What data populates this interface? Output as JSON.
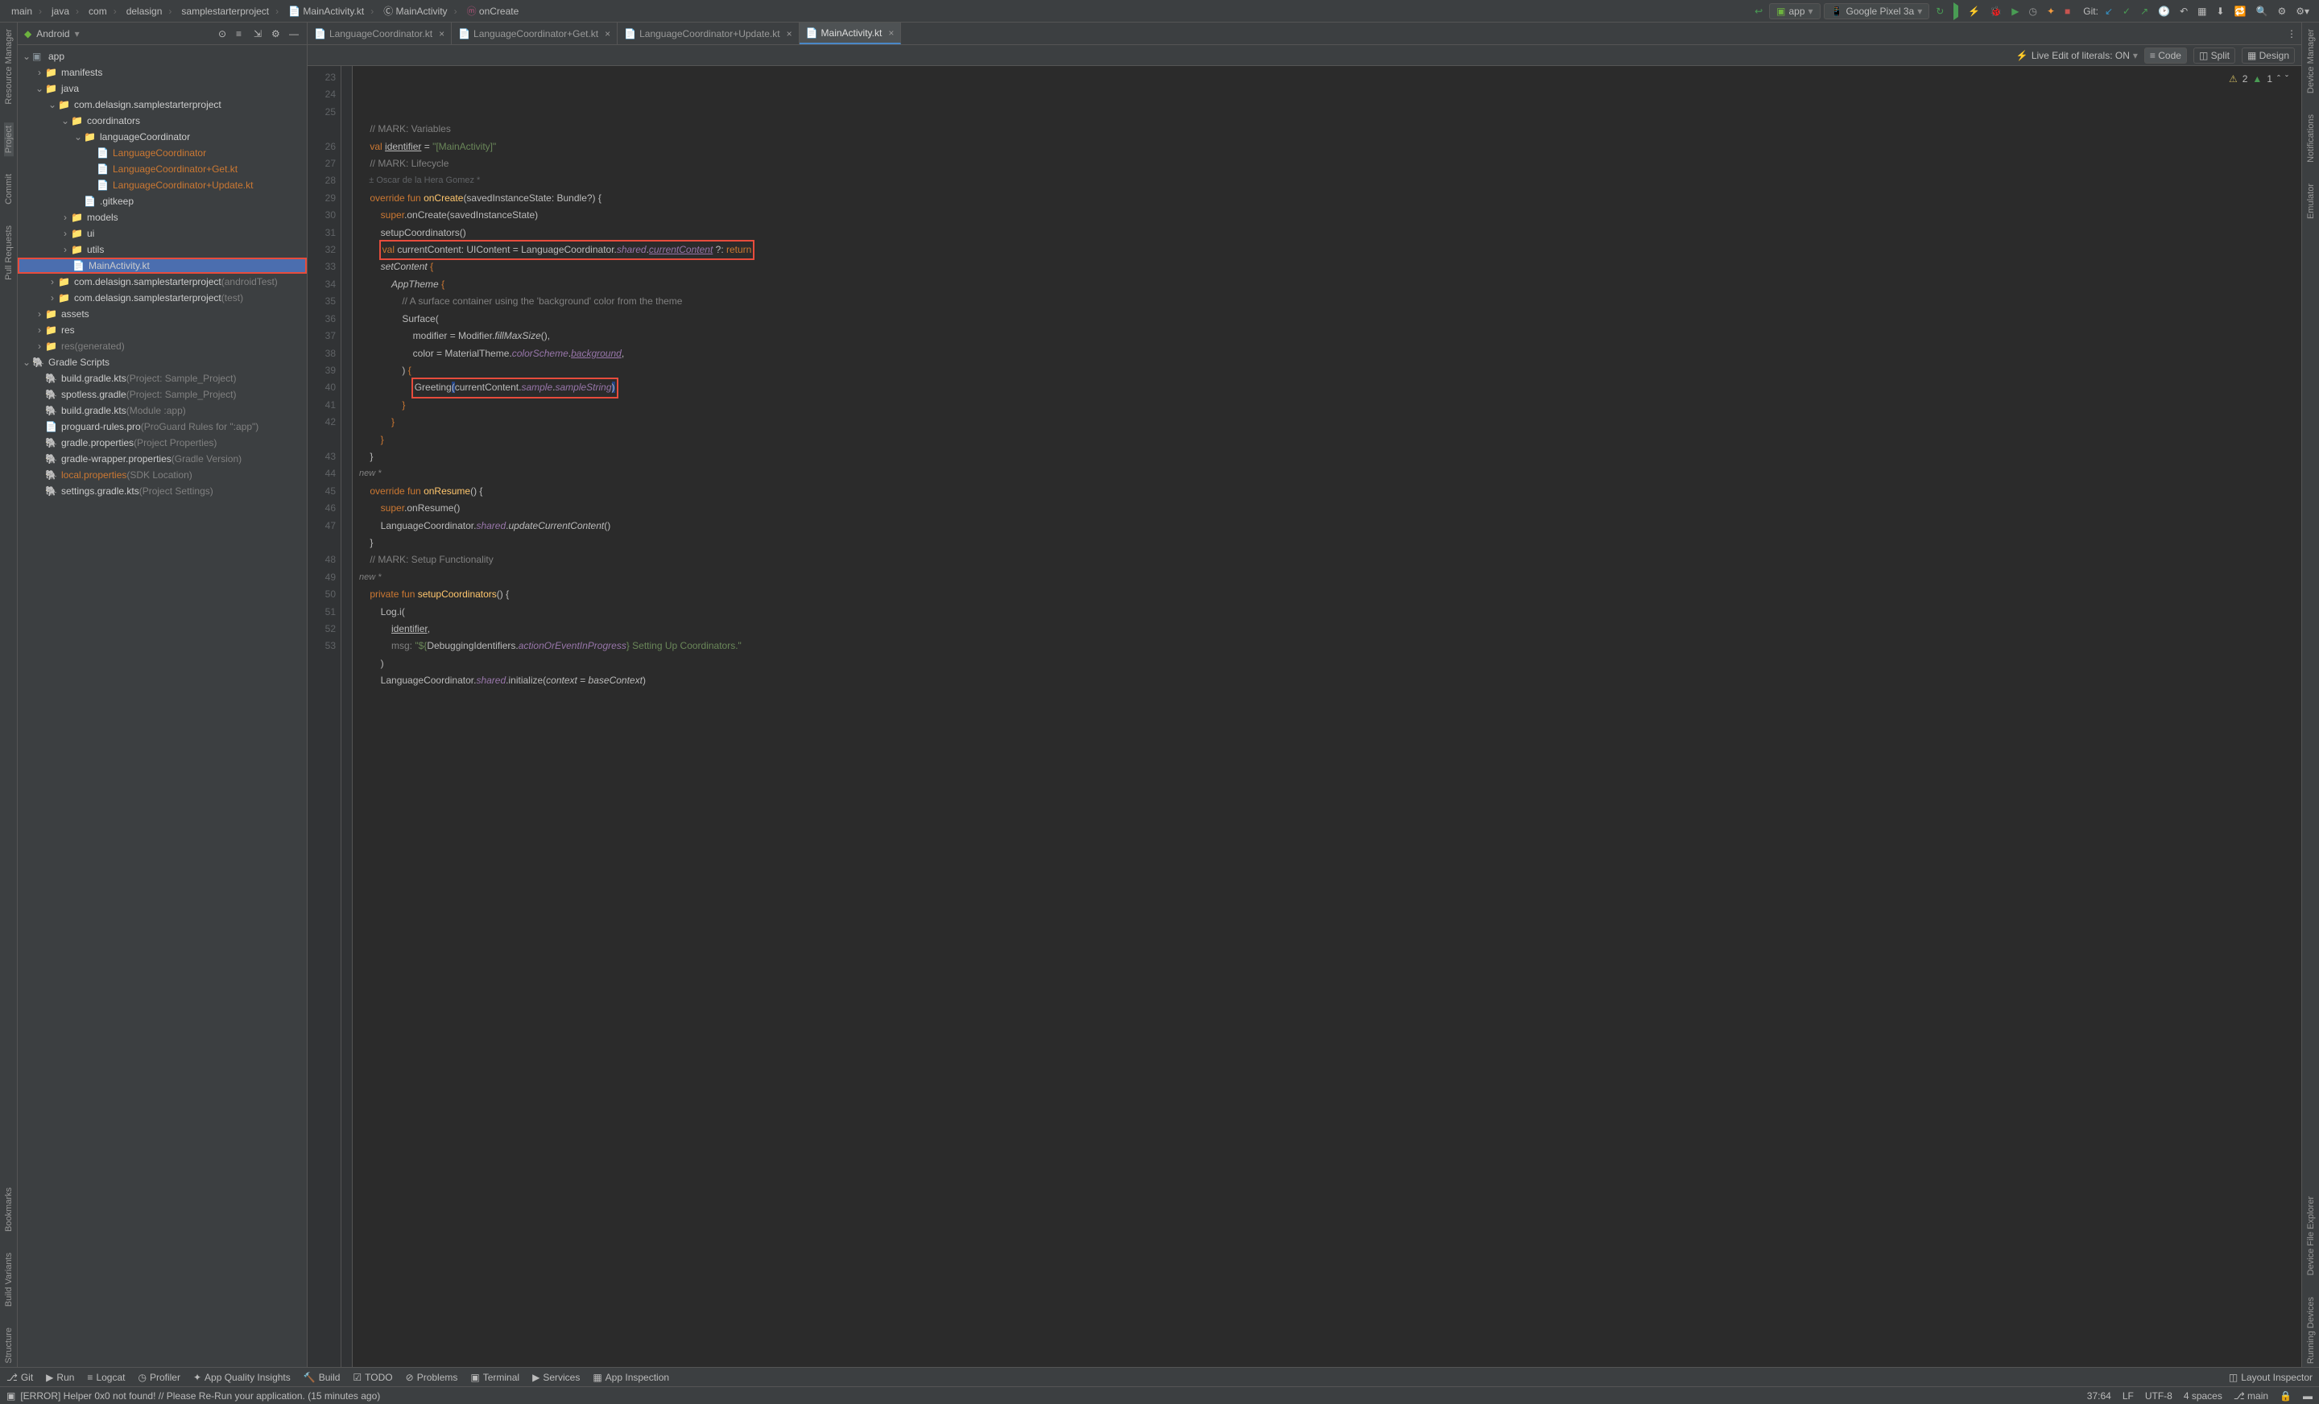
{
  "breadcrumbs": [
    "main",
    "java",
    "com",
    "delasign",
    "samplestarterproject",
    "MainActivity.kt",
    "MainActivity",
    "onCreate"
  ],
  "run_config": "app",
  "device_target": "Google Pixel 3a",
  "git_label": "Git:",
  "left_tools": {
    "resource_manager": "Resource Manager",
    "project": "Project",
    "commit": "Commit",
    "pull_requests": "Pull Requests",
    "bookmarks": "Bookmarks",
    "build_variants": "Build Variants",
    "structure": "Structure"
  },
  "right_tools": {
    "device_manager": "Device Manager",
    "notifications": "Notifications",
    "emulator": "Emulator",
    "device_file_explorer": "Device File Explorer",
    "running_devices": "Running Devices"
  },
  "project_panel": {
    "title": "Android",
    "tree": [
      {
        "d": 0,
        "t": "app",
        "icon": "module",
        "open": true
      },
      {
        "d": 1,
        "t": "manifests",
        "icon": "folder",
        "open": false,
        "arrow": ">"
      },
      {
        "d": 1,
        "t": "java",
        "icon": "folder",
        "open": true,
        "arrow": "v"
      },
      {
        "d": 2,
        "t": "com.delasign.samplestarterproject",
        "icon": "pkg",
        "open": true,
        "arrow": "v"
      },
      {
        "d": 3,
        "t": "coordinators",
        "icon": "pkg",
        "open": true,
        "arrow": "v"
      },
      {
        "d": 4,
        "t": "languageCoordinator",
        "icon": "pkg",
        "open": true,
        "arrow": "v"
      },
      {
        "d": 5,
        "t": "LanguageCoordinator",
        "icon": "kt",
        "cls": "orange"
      },
      {
        "d": 5,
        "t": "LanguageCoordinator+Get.kt",
        "icon": "kt",
        "cls": "orange"
      },
      {
        "d": 5,
        "t": "LanguageCoordinator+Update.kt",
        "icon": "kt",
        "cls": "orange"
      },
      {
        "d": 4,
        "t": ".gitkeep",
        "icon": "file"
      },
      {
        "d": 3,
        "t": "models",
        "icon": "pkg",
        "arrow": ">"
      },
      {
        "d": 3,
        "t": "ui",
        "icon": "pkg",
        "arrow": ">"
      },
      {
        "d": 3,
        "t": "utils",
        "icon": "pkg",
        "arrow": ">"
      },
      {
        "d": 3,
        "t": "MainActivity.kt",
        "icon": "kt",
        "sel": true,
        "redborder": true
      },
      {
        "d": 2,
        "t": "com.delasign.samplestarterproject",
        "suffix": " (androidTest)",
        "icon": "pkg",
        "arrow": ">"
      },
      {
        "d": 2,
        "t": "com.delasign.samplestarterproject",
        "suffix": " (test)",
        "icon": "pkg",
        "arrow": ">"
      },
      {
        "d": 1,
        "t": "assets",
        "icon": "folder",
        "arrow": ">"
      },
      {
        "d": 1,
        "t": "res",
        "icon": "folder",
        "arrow": ">"
      },
      {
        "d": 1,
        "t": "res",
        "suffix": " (generated)",
        "icon": "folder",
        "arrow": ">",
        "dim": true
      },
      {
        "d": 0,
        "t": "Gradle Scripts",
        "icon": "gradle",
        "open": true,
        "arrow": "v"
      },
      {
        "d": 1,
        "t": "build.gradle.kts",
        "suffix": " (Project: Sample_Project)",
        "icon": "gradlef"
      },
      {
        "d": 1,
        "t": "spotless.gradle",
        "suffix": " (Project: Sample_Project)",
        "icon": "gradlef"
      },
      {
        "d": 1,
        "t": "build.gradle.kts",
        "suffix": " (Module :app)",
        "icon": "gradlef"
      },
      {
        "d": 1,
        "t": "proguard-rules.pro",
        "suffix": " (ProGuard Rules for \":app\")",
        "icon": "file"
      },
      {
        "d": 1,
        "t": "gradle.properties",
        "suffix": " (Project Properties)",
        "icon": "gradlef"
      },
      {
        "d": 1,
        "t": "gradle-wrapper.properties",
        "suffix": " (Gradle Version)",
        "icon": "gradlef"
      },
      {
        "d": 1,
        "t": "local.properties",
        "suffix": " (SDK Location)",
        "icon": "gradlef",
        "cls": "orange"
      },
      {
        "d": 1,
        "t": "settings.gradle.kts",
        "suffix": " (Project Settings)",
        "icon": "gradlef"
      }
    ]
  },
  "tabs": [
    {
      "name": "LanguageCoordinator.kt",
      "active": false
    },
    {
      "name": "LanguageCoordinator+Get.kt",
      "active": false
    },
    {
      "name": "LanguageCoordinator+Update.kt",
      "active": false
    },
    {
      "name": "MainActivity.kt",
      "active": true
    }
  ],
  "viewbar": {
    "live_edit": "Live Edit of literals: ON",
    "code": "Code",
    "split": "Split",
    "design": "Design"
  },
  "problems": {
    "warnings": "2",
    "typos": "1"
  },
  "gutter_start": 23,
  "author_line": "Oscar de la Hera Gomez *",
  "code_lines": [
    {
      "n": 23,
      "html": "    <span class='cm'>// MARK: Variables</span>"
    },
    {
      "n": 24,
      "html": "    <span class='kw'>val</span> <span class='und'>identifier</span> = <span class='str'>\"[MainActivity]\"</span>"
    },
    {
      "n": 25,
      "html": "    <span class='cm'>// MARK: Lifecycle</span>",
      "after_author": true
    },
    {
      "n": 26,
      "html": "    <span class='kw'>override fun</span> <span class='fn'>onCreate</span>(savedInstanceState: Bundle?) {"
    },
    {
      "n": 27,
      "html": "        <span class='kw'>super</span>.onCreate(savedInstanceState)"
    },
    {
      "n": 28,
      "html": "        setupCoordinators()"
    },
    {
      "n": 29,
      "html": "        <span class='redbox'><span class='kw'>val</span> currentContent: UIContent = LanguageCoordinator.<span class='prop'>shared</span>.<span class='prop und'>currentContent</span> ?: <span class='kw'>return</span></span>"
    },
    {
      "n": 30,
      "html": "        <span class='it'>setContent</span> <span class='kw'>{</span>"
    },
    {
      "n": 31,
      "html": "            <span class='it'>AppTheme</span> <span class='kw'>{</span>"
    },
    {
      "n": 32,
      "html": "                <span class='cm'>// A surface container using the 'background' color from the theme</span>"
    },
    {
      "n": 33,
      "html": "                Surface("
    },
    {
      "n": 34,
      "html": "                    modifier = Modifier.<span class='it'>fillMaxSize</span>(),"
    },
    {
      "n": 35,
      "html": "                    color = MaterialTheme.<span class='prop'>colorScheme</span>.<span class='prop und'>background</span>,"
    },
    {
      "n": 36,
      "html": "                ) <span class='kw'>{</span>"
    },
    {
      "n": 37,
      "html": "                    <span class='redbox'>Greeting<span style='background:#214283'>(</span>currentContent.<span class='prop'>sample</span>.<span class='prop'>sampleString</span><span style='background:#214283'>)</span></span>",
      "caret": true
    },
    {
      "n": 38,
      "html": "                <span class='kw'>}</span>"
    },
    {
      "n": 39,
      "html": "            <span class='kw'>}</span>"
    },
    {
      "n": 40,
      "html": "        <span class='kw'>}</span>"
    },
    {
      "n": 41,
      "html": "    }"
    },
    {
      "n": 42,
      "html": ""
    },
    {
      "new_marker": "new *"
    },
    {
      "n": 43,
      "html": "    <span class='kw'>override fun</span> <span class='fn'>onResume</span>() {"
    },
    {
      "n": 44,
      "html": "        <span class='kw'>super</span>.onResume()"
    },
    {
      "n": 45,
      "html": "        LanguageCoordinator.<span class='prop'>shared</span>.<span class='it'>updateCurrentContent</span>()"
    },
    {
      "n": 46,
      "html": "    }"
    },
    {
      "n": 47,
      "html": "    <span class='cm'>// MARK: Setup Functionality</span>"
    },
    {
      "new_marker": "new *"
    },
    {
      "n": 48,
      "html": "    <span class='kw'>private fun</span> <span class='fn'>setupCoordinators</span>() {"
    },
    {
      "n": 49,
      "html": "        Log.i("
    },
    {
      "n": 50,
      "html": "            <span class='und'>identifier</span>,"
    },
    {
      "n": 51,
      "html": "            <span class='cm'>msg:</span> <span class='str'>\"${</span>DebuggingIdentifiers.<span class='prop'>actionOrEventInProgress</span><span class='str'>} Setting Up Coordinators.\"</span>"
    },
    {
      "n": 52,
      "html": "        )"
    },
    {
      "n": 53,
      "html": "        LanguageCoordinator.<span class='prop'>shared</span>.initialize(<span class='it'>context</span> = <span class='it'>baseContext</span>)"
    }
  ],
  "bottom_tools": {
    "git": "Git",
    "run": "Run",
    "logcat": "Logcat",
    "profiler": "Profiler",
    "app_quality": "App Quality Insights",
    "build": "Build",
    "todo": "TODO",
    "problems": "Problems",
    "terminal": "Terminal",
    "services": "Services",
    "app_inspection": "App Inspection",
    "layout_inspector": "Layout Inspector"
  },
  "status": {
    "message": "[ERROR] Helper 0x0 not found! // Please Re-Run your application. (15 minutes ago)",
    "caret": "37:64",
    "line_sep": "LF",
    "encoding": "UTF-8",
    "indent": "4 spaces",
    "branch": "main"
  }
}
